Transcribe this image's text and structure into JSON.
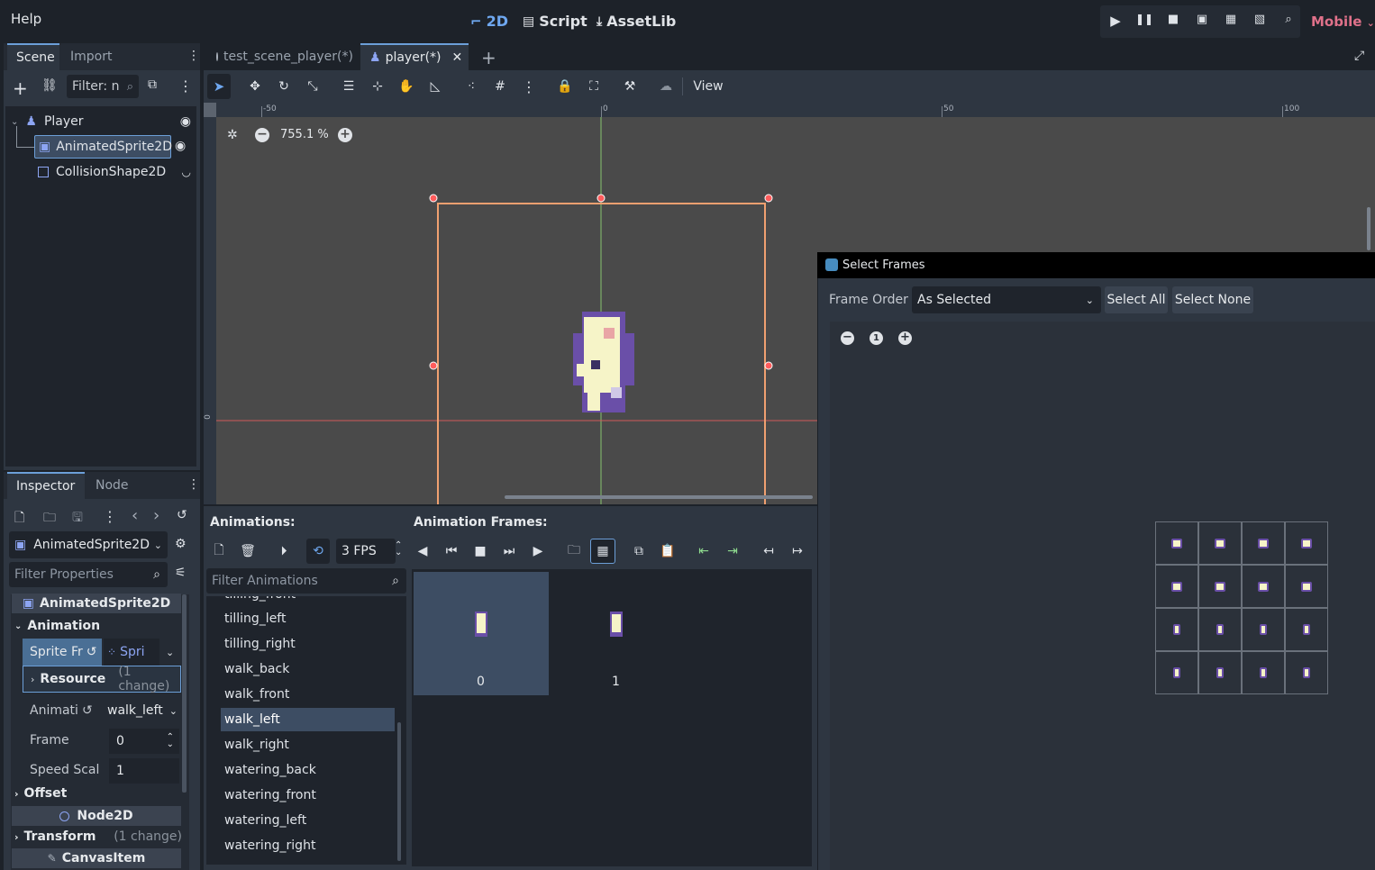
{
  "menu": {
    "help": "Help"
  },
  "workspaces": {
    "w2d": "2D",
    "script": "Script",
    "assetlib": "AssetLib"
  },
  "renderer": "Mobile",
  "scene_dock": {
    "tabs": [
      "Scene",
      "Import"
    ],
    "filter_placeholder": "Filter: n",
    "tree": [
      "Player",
      "AnimatedSprite2D",
      "CollisionShape2D"
    ]
  },
  "editor_tabs": [
    "test_scene_player(*)",
    "player(*)"
  ],
  "toolbar": {
    "view": "View"
  },
  "viewport": {
    "zoom": "755.1 %",
    "ruler_top": [
      "-50",
      "0",
      "50",
      "100"
    ],
    "ruler_left": [
      "0"
    ]
  },
  "inspector": {
    "tabs": [
      "Inspector",
      "Node"
    ],
    "node_select": "AnimatedSprite2D",
    "filter_placeholder": "Filter Properties",
    "class_header": "AnimatedSprite2D",
    "section_animation": "Animation",
    "sprite_frames_label": "Sprite Fr",
    "sprite_frames_value": "Spri",
    "resource_label": "Resource",
    "resource_change": "(1 change)",
    "animation_label": "Animati",
    "animation_value": "walk_left",
    "frame_label": "Frame",
    "frame_value": "0",
    "speed_label": "Speed Scal",
    "speed_value": "1",
    "offset": "Offset",
    "node2d": "Node2D",
    "transform": "Transform",
    "transform_change": "(1 change)",
    "canvasitem": "CanvasItem"
  },
  "animations": {
    "header": "Animations:",
    "frames_header": "Animation Frames:",
    "fps": "3 FPS",
    "filter_placeholder": "Filter Animations",
    "partial_top": "tilling_front",
    "items": [
      "tilling_left",
      "tilling_right",
      "walk_back",
      "walk_front",
      "walk_left",
      "walk_right",
      "watering_back",
      "watering_front",
      "watering_left",
      "watering_right"
    ],
    "selected": "walk_left",
    "frames": [
      "0",
      "1"
    ]
  },
  "dialog": {
    "title": "Select Frames",
    "frame_order_label": "Frame Order",
    "frame_order_value": "As Selected",
    "select_all": "Select All",
    "select_none": "Select None"
  },
  "colors": {
    "accent": "#6c9fd8",
    "selection": "#3d4d63",
    "viewport": "#4a4a4a",
    "bounds": "#f0a070",
    "handle": "#ff5c5c"
  }
}
